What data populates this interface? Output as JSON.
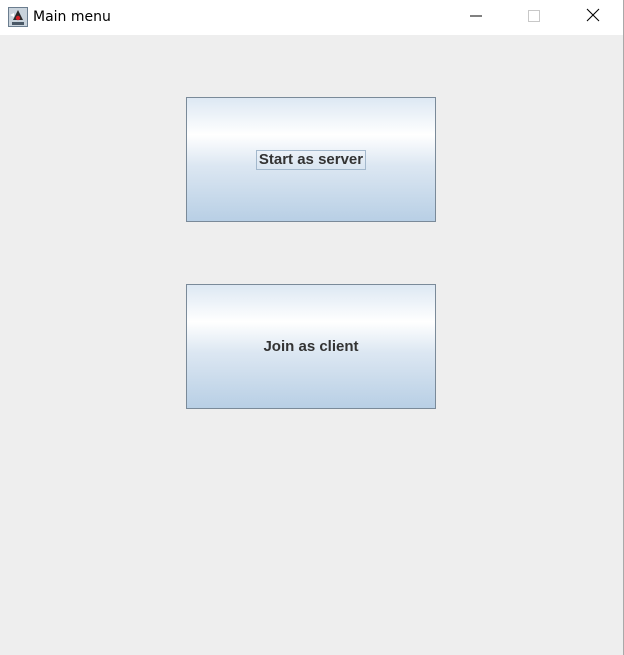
{
  "window": {
    "title": "Main menu",
    "app_icon": "java-duke-icon",
    "controls": {
      "minimize_icon": "minimize-icon",
      "maximize_icon": "maximize-icon",
      "close_icon": "close-icon"
    }
  },
  "main": {
    "buttons": [
      {
        "label": "Start as server",
        "focused": true
      },
      {
        "label": "Join as client",
        "focused": false
      }
    ]
  },
  "colors": {
    "background": "#eeeeee",
    "button_border": "#7a8a99",
    "button_gradient_light": "#ffffff",
    "button_gradient_dark": "#b8cfe5",
    "button_text": "#333333"
  }
}
